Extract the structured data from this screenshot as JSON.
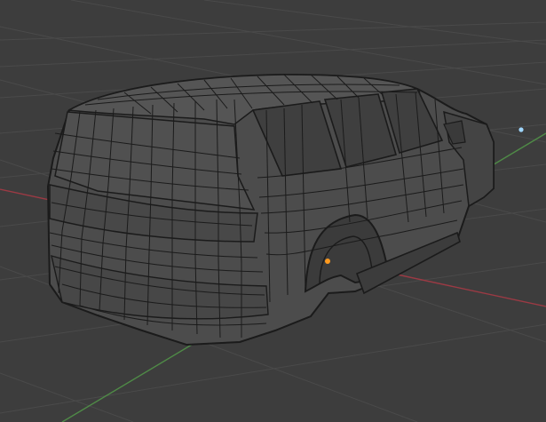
{
  "viewport": {
    "background": "#3d3d3d",
    "grid_color": "#4a4a4a",
    "x_axis_color": "#9b3a44",
    "y_axis_color": "#4f8a47"
  },
  "scene": {
    "object": "car-body-mesh",
    "display_mode": "wireframe",
    "mesh_color": "#1b1b1b",
    "mesh_fill": "#4c4c4c",
    "selected_vertex_color": "#ff9a1e",
    "light_color": "#9fd6ff"
  }
}
